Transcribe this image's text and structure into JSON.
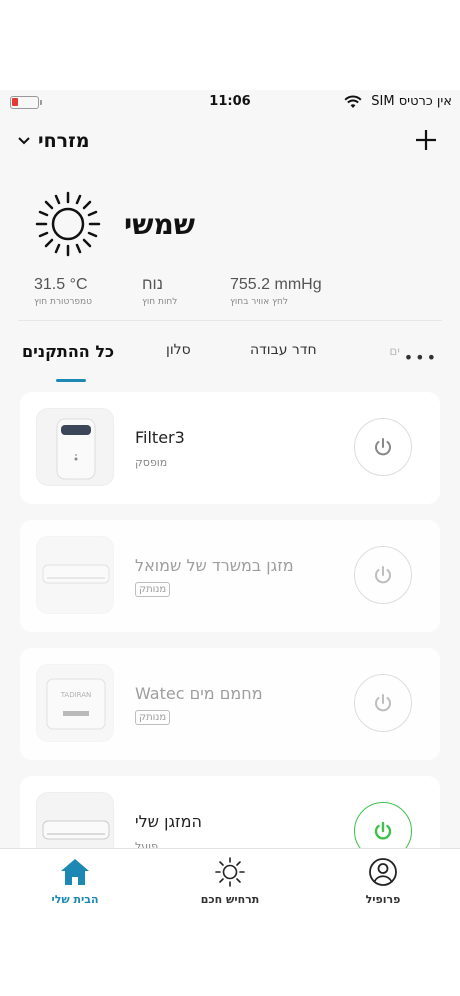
{
  "status_bar": {
    "time": "11:06",
    "carrier": "אין כרטיס SIM"
  },
  "header": {
    "home_name": "מזרחי",
    "add_icon": "plus-icon"
  },
  "weather": {
    "condition": "שמשי",
    "metrics": [
      {
        "value": "31.5 °C",
        "label": "טמפרטורת חוץ"
      },
      {
        "value": "נוח",
        "label": "לחות חוץ"
      },
      {
        "value": "755.2 mmHg",
        "label": "לחץ אוויר בחוץ"
      }
    ]
  },
  "tabs": {
    "items": [
      "כל ההתקנים",
      "סלון",
      "חדר עבודה",
      "ים"
    ],
    "active": "כל ההתקנים"
  },
  "devices": [
    {
      "name": "Filter3",
      "status": "מופסק",
      "offline": false,
      "power_on": false,
      "brand": ""
    },
    {
      "name": "מזגן במשרד של שמואל",
      "status": "מנותק",
      "offline": true,
      "power_on": false,
      "brand": ""
    },
    {
      "name": "מחמם מים Watec",
      "status": "מנותק",
      "offline": true,
      "power_on": false,
      "brand": "TADIRAN"
    },
    {
      "name": "המזגן שלי",
      "status": "פועל",
      "offline": false,
      "power_on": true,
      "brand": ""
    }
  ],
  "tabbar": {
    "items": [
      {
        "label": "הבית שלי",
        "icon": "home-icon"
      },
      {
        "label": "תרחיש חכם",
        "icon": "sun-icon"
      },
      {
        "label": "פרופיל",
        "icon": "profile-icon"
      }
    ]
  },
  "colors": {
    "accent": "#1e88b4",
    "power_on": "#3cc14a",
    "battery_low": "#e53935"
  }
}
